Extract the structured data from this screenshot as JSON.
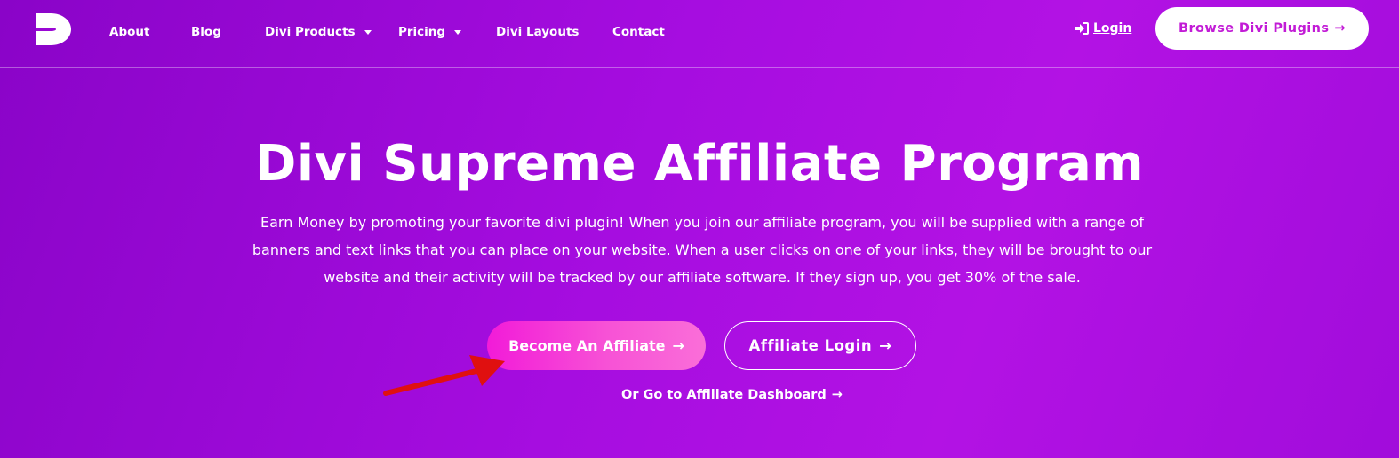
{
  "nav": {
    "items": [
      {
        "label": "About",
        "dropdown": false
      },
      {
        "label": "Blog",
        "dropdown": false
      },
      {
        "label": "Divi Products",
        "dropdown": true
      },
      {
        "label": "Pricing",
        "dropdown": true
      },
      {
        "label": "Divi Layouts",
        "dropdown": false
      },
      {
        "label": "Contact",
        "dropdown": false
      }
    ],
    "login_label": "Login",
    "login_icon": "sign-in-icon",
    "browse_label": "Browse Divi Plugins",
    "browse_arrow": "→"
  },
  "hero": {
    "title": "Divi Supreme Affiliate Program",
    "description": "Earn Money by promoting your favorite divi plugin! When you join our affiliate program, you will be supplied with a range of banners and text links that you can place on your website. When a user clicks on one of your links, they will be brought to our website and their activity will be tracked by our affiliate software. If they sign up, you get 30% of the sale.",
    "become_label": "Become An Affiliate",
    "affiliate_login_label": "Affiliate Login",
    "dashboard_label": "Or Go to Affiliate Dashboard",
    "arrow": "→"
  },
  "colors": {
    "background_start": "#8a04c8",
    "background_end": "#b312e4",
    "accent": "#c21bd6",
    "button_pink": "#f21bd8",
    "annotation_red": "#e01010"
  }
}
